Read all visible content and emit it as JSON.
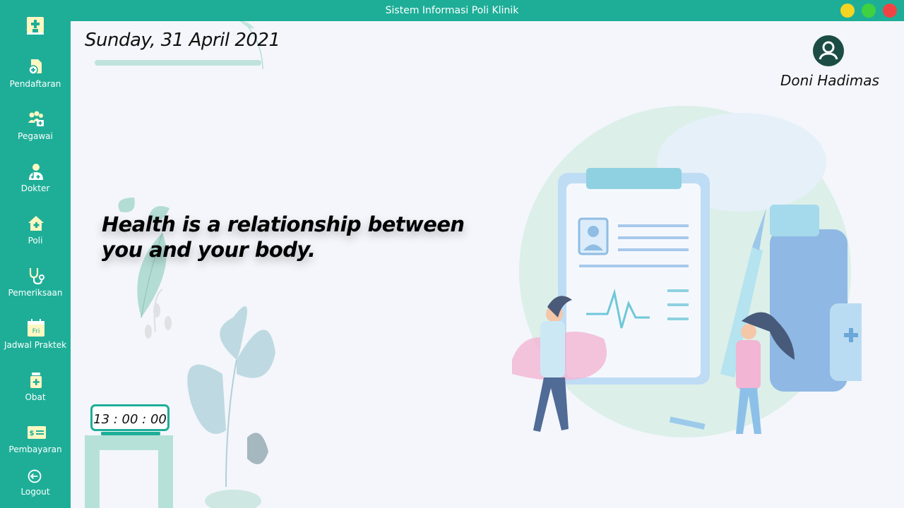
{
  "window": {
    "title": "Sistem Informasi Poli Klinik",
    "controls": {
      "minimize_color": "#f5d422",
      "maximize_color": "#3fd13f",
      "close_color": "#f04444"
    }
  },
  "colors": {
    "accent": "#1eae98",
    "background": "#f4f6fb",
    "icon_highlight": "#fff7c2"
  },
  "sidebar": {
    "logo_icon": "hospital-icon",
    "items": [
      {
        "label": "Pendaftaran",
        "icon": "document-add-icon"
      },
      {
        "label": "Pegawai",
        "icon": "staff-icon"
      },
      {
        "label": "Dokter",
        "icon": "doctor-icon"
      },
      {
        "label": "Poli",
        "icon": "clinic-home-icon"
      },
      {
        "label": "Pemeriksaan",
        "icon": "stethoscope-icon"
      },
      {
        "label": "Jadwal Praktek",
        "icon": "calendar-icon",
        "icon_text": "Fri"
      },
      {
        "label": "Obat",
        "icon": "medicine-icon"
      },
      {
        "label": "Pembayaran",
        "icon": "payment-icon"
      },
      {
        "label": "Logout",
        "icon": "logout-icon"
      }
    ]
  },
  "header": {
    "date": "Sunday, 31 April 2021",
    "user_name": "Doni Hadimas",
    "avatar_icon": "user-avatar-icon"
  },
  "main": {
    "quote": "Health is a relationship between you and your body.",
    "clock": "13 : 00 : 00"
  }
}
